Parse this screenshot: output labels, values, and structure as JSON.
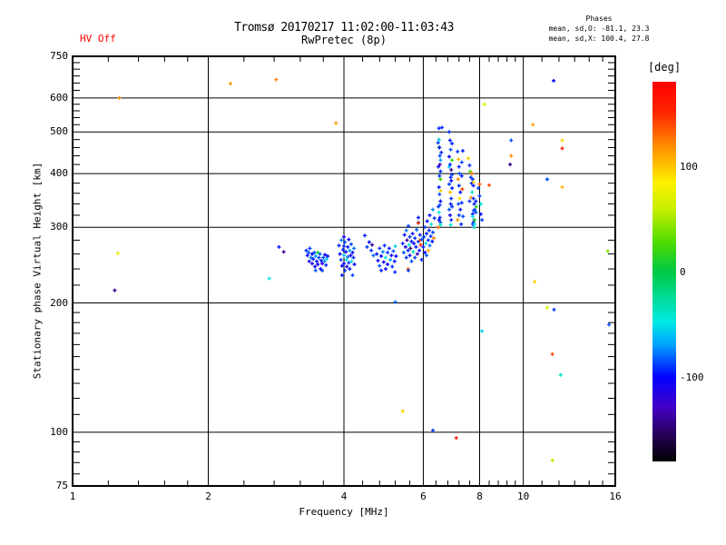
{
  "header": {
    "hv_status": "HV Off",
    "title_line1": "Tromsø 20170217 11:02:00-11:03:43",
    "title_line2": "RwPretec (8p)",
    "stats_title": "Phases",
    "stats_line1": "mean, sd,O: -81.1, 23.3",
    "stats_line2": "mean, sd,X: 100.4, 27.8"
  },
  "axes": {
    "x_label": "Frequency [MHz]",
    "y_label": "Stationary phase Virtual Height [km]"
  },
  "colorbar": {
    "label": "[deg]",
    "range": [
      -180,
      180
    ],
    "tick_values": [
      100,
      0,
      -100
    ],
    "tick_labels": [
      "100",
      "0",
      "-100"
    ],
    "stops": [
      [
        180,
        "#ff0000"
      ],
      [
        150,
        "#ff2600"
      ],
      [
        122,
        "#ff8400"
      ],
      [
        100,
        "#ffc300"
      ],
      [
        84,
        "#fdf200"
      ],
      [
        58,
        "#c2ee00"
      ],
      [
        28,
        "#4fdc00"
      ],
      [
        0,
        "#00c845"
      ],
      [
        -26,
        "#00dc9b"
      ],
      [
        -48,
        "#00e9e4"
      ],
      [
        -70,
        "#009fff"
      ],
      [
        -100,
        "#0202ff"
      ],
      [
        -128,
        "#4300c8"
      ],
      [
        -156,
        "#250054"
      ],
      [
        -180,
        "#000000"
      ]
    ]
  },
  "chart_data": {
    "type": "scatter",
    "title": "Tromsø 20170217 11:02:00-11:03:43",
    "subtitle": "RwPretec (8p)",
    "xlabel": "Frequency [MHz]",
    "ylabel": "Stationary phase Virtual Height [km]",
    "x_scale": "log",
    "y_scale": "log",
    "xlim": [
      1,
      16
    ],
    "ylim": [
      75,
      750
    ],
    "x_major_ticks": [
      1,
      2,
      4,
      6,
      8,
      10,
      16
    ],
    "y_major_ticks": [
      75,
      100,
      200,
      300,
      400,
      500,
      600,
      750
    ],
    "x_gridlines": [
      2,
      4,
      6,
      8,
      10
    ],
    "y_gridlines": [
      100,
      200,
      300,
      400,
      500,
      600
    ],
    "x_minor_ticks": [
      1.2,
      1.4,
      1.6,
      1.8,
      2.4,
      2.8,
      3.2,
      3.6,
      4.4,
      4.8,
      5.2,
      5.6,
      6.4,
      6.8,
      7.2,
      7.6,
      8.4,
      8.8,
      9.2,
      9.6,
      11,
      12,
      13,
      14,
      15
    ],
    "y_minor_ticks": [
      80,
      85,
      90,
      95,
      110,
      120,
      130,
      140,
      150,
      160,
      170,
      180,
      190,
      220,
      240,
      260,
      280,
      320,
      340,
      360,
      380,
      420,
      440,
      460,
      480,
      520,
      540,
      560,
      580,
      625,
      650,
      675,
      700,
      725
    ],
    "grid": true,
    "legend_position": "right-colorbar",
    "point_marker": "plus",
    "color_value": "phase [deg]",
    "points": [
      [
        1.24,
        214,
        -140
      ],
      [
        1.26,
        261,
        75
      ],
      [
        1.27,
        600,
        120
      ],
      [
        2.24,
        648,
        118
      ],
      [
        2.73,
        228,
        -48
      ],
      [
        2.83,
        662,
        125
      ],
      [
        2.87,
        270,
        -95
      ],
      [
        2.94,
        263,
        -140
      ],
      [
        3.84,
        524,
        115
      ],
      [
        3.3,
        265,
        -95
      ],
      [
        3.32,
        258,
        -102
      ],
      [
        3.34,
        262,
        -85
      ],
      [
        3.35,
        250,
        -106
      ],
      [
        3.36,
        268,
        -92
      ],
      [
        3.38,
        255,
        -78
      ],
      [
        3.4,
        260,
        -100
      ],
      [
        3.4,
        247,
        -112
      ],
      [
        3.42,
        253,
        -96
      ],
      [
        3.44,
        262,
        -88
      ],
      [
        3.45,
        243,
        -104
      ],
      [
        3.46,
        257,
        -72
      ],
      [
        3.46,
        238,
        -84
      ],
      [
        3.48,
        250,
        -98
      ],
      [
        3.5,
        262,
        10
      ],
      [
        3.5,
        246,
        -108
      ],
      [
        3.52,
        255,
        -90
      ],
      [
        3.54,
        260,
        -82
      ],
      [
        3.55,
        240,
        -100
      ],
      [
        3.56,
        251,
        -95
      ],
      [
        3.58,
        247,
        -118
      ],
      [
        3.58,
        238,
        -90
      ],
      [
        3.6,
        255,
        -86
      ],
      [
        3.62,
        250,
        -75
      ],
      [
        3.63,
        259,
        -102
      ],
      [
        3.65,
        245,
        -94
      ],
      [
        3.66,
        253,
        -60
      ],
      [
        3.68,
        257,
        -98
      ],
      [
        3.9,
        272,
        -96
      ],
      [
        3.92,
        260,
        -104
      ],
      [
        3.94,
        252,
        -88
      ],
      [
        3.95,
        280,
        -76
      ],
      [
        3.96,
        244,
        -100
      ],
      [
        3.96,
        232,
        -95
      ],
      [
        3.98,
        266,
        -92
      ],
      [
        4.0,
        285,
        -108
      ],
      [
        4.0,
        271,
        -95
      ],
      [
        4.0,
        258,
        -60
      ],
      [
        4.0,
        247,
        -102
      ],
      [
        4.02,
        277,
        -84
      ],
      [
        4.02,
        238,
        -90
      ],
      [
        4.04,
        263,
        -98
      ],
      [
        4.05,
        252,
        -45
      ],
      [
        4.06,
        243,
        -110
      ],
      [
        4.08,
        270,
        -94
      ],
      [
        4.08,
        256,
        -80
      ],
      [
        4.1,
        281,
        -100
      ],
      [
        4.1,
        248,
        -90
      ],
      [
        4.12,
        265,
        -70
      ],
      [
        4.12,
        240,
        -96
      ],
      [
        4.14,
        258,
        -105
      ],
      [
        4.15,
        274,
        -88
      ],
      [
        4.16,
        250,
        -52
      ],
      [
        4.18,
        262,
        -98
      ],
      [
        4.18,
        232,
        -86
      ],
      [
        4.2,
        255,
        -92
      ],
      [
        4.21,
        268,
        -78
      ],
      [
        4.22,
        246,
        -100
      ],
      [
        4.45,
        287,
        -95
      ],
      [
        4.5,
        270,
        -88
      ],
      [
        4.55,
        277,
        -100
      ],
      [
        4.6,
        265,
        -92
      ],
      [
        4.62,
        273,
        -140
      ],
      [
        4.65,
        258,
        -80
      ],
      [
        4.73,
        260,
        -96
      ],
      [
        4.76,
        251,
        -104
      ],
      [
        4.8,
        268,
        -90
      ],
      [
        4.8,
        244,
        -84
      ],
      [
        4.84,
        257,
        -100
      ],
      [
        4.84,
        238,
        -95
      ],
      [
        4.88,
        263,
        -75
      ],
      [
        4.9,
        249,
        -108
      ],
      [
        4.92,
        272,
        -92
      ],
      [
        4.95,
        255,
        -45
      ],
      [
        4.95,
        240,
        -98
      ],
      [
        5.0,
        262,
        -88
      ],
      [
        5.0,
        246,
        -100
      ],
      [
        5.04,
        268,
        -94
      ],
      [
        5.07,
        252,
        -70
      ],
      [
        5.1,
        258,
        -102
      ],
      [
        5.12,
        243,
        -90
      ],
      [
        5.15,
        264,
        -85
      ],
      [
        5.18,
        250,
        -96
      ],
      [
        5.2,
        271,
        -55
      ],
      [
        5.22,
        257,
        -100
      ],
      [
        5.19,
        236,
        -92
      ],
      [
        5.55,
        240,
        128
      ],
      [
        5.2,
        201,
        -80
      ],
      [
        5.4,
        275,
        -95
      ],
      [
        5.43,
        262,
        -85
      ],
      [
        5.45,
        288,
        -100
      ],
      [
        5.48,
        270,
        -110
      ],
      [
        5.5,
        255,
        -92
      ],
      [
        5.5,
        295,
        -78
      ],
      [
        5.52,
        280,
        -135
      ],
      [
        5.55,
        265,
        -96
      ],
      [
        5.56,
        302,
        -88
      ],
      [
        5.56,
        238,
        -90
      ],
      [
        5.58,
        273,
        -45
      ],
      [
        5.6,
        258,
        -100
      ],
      [
        5.6,
        285,
        -90
      ],
      [
        5.62,
        268,
        -150
      ],
      [
        5.65,
        278,
        -94
      ],
      [
        5.65,
        250,
        -85
      ],
      [
        5.68,
        290,
        -98
      ],
      [
        5.7,
        263,
        -30
      ],
      [
        5.72,
        275,
        -105
      ],
      [
        5.75,
        283,
        -92
      ],
      [
        5.75,
        255,
        -88
      ],
      [
        5.78,
        270,
        -96
      ],
      [
        5.8,
        296,
        -82
      ],
      [
        5.82,
        260,
        -135
      ],
      [
        5.85,
        278,
        -90
      ],
      [
        5.85,
        308,
        -70
      ],
      [
        5.85,
        316,
        -96
      ],
      [
        5.88,
        265,
        -100
      ],
      [
        5.9,
        288,
        -94
      ],
      [
        5.9,
        280,
        140
      ],
      [
        5.85,
        307,
        150
      ],
      [
        5.92,
        273,
        155
      ],
      [
        5.95,
        281,
        -86
      ],
      [
        5.95,
        252,
        -92
      ],
      [
        6.0,
        270,
        -95
      ],
      [
        6.02,
        285,
        -88
      ],
      [
        6.05,
        262,
        -100
      ],
      [
        6.05,
        300,
        -92
      ],
      [
        6.08,
        275,
        -55
      ],
      [
        6.1,
        290,
        -96
      ],
      [
        6.1,
        258,
        -85
      ],
      [
        6.12,
        310,
        -100
      ],
      [
        6.15,
        280,
        -90
      ],
      [
        6.15,
        265,
        110
      ],
      [
        6.18,
        295,
        -94
      ],
      [
        6.2,
        272,
        -80
      ],
      [
        6.2,
        320,
        -98
      ],
      [
        6.23,
        286,
        -92
      ],
      [
        6.25,
        305,
        -45
      ],
      [
        6.28,
        278,
        -96
      ],
      [
        6.3,
        292,
        -88
      ],
      [
        6.3,
        330,
        -75
      ],
      [
        6.33,
        283,
        125
      ],
      [
        6.35,
        315,
        -90
      ],
      [
        6.47,
        472,
        -88
      ],
      [
        6.48,
        335,
        -90
      ],
      [
        6.48,
        415,
        -98
      ],
      [
        6.48,
        300,
        130
      ],
      [
        6.5,
        510,
        -95
      ],
      [
        6.5,
        480,
        -60
      ],
      [
        6.5,
        460,
        15
      ],
      [
        6.5,
        372,
        -96
      ],
      [
        6.5,
        325,
        -45
      ],
      [
        6.5,
        312,
        -96
      ],
      [
        6.52,
        460,
        -100
      ],
      [
        6.52,
        358,
        -85
      ],
      [
        6.52,
        395,
        -90
      ],
      [
        6.53,
        440,
        -88
      ],
      [
        6.53,
        420,
        -135
      ],
      [
        6.53,
        316,
        -94
      ],
      [
        6.53,
        338,
        -86
      ],
      [
        6.55,
        405,
        -92
      ],
      [
        6.55,
        388,
        25
      ],
      [
        6.55,
        345,
        -100
      ],
      [
        6.55,
        308,
        -88
      ],
      [
        6.55,
        430,
        -70
      ],
      [
        6.55,
        365,
        95
      ],
      [
        6.55,
        304,
        -40
      ],
      [
        6.58,
        448,
        -94
      ],
      [
        6.6,
        512,
        -92
      ],
      [
        6.85,
        500,
        -92
      ],
      [
        6.85,
        438,
        -100
      ],
      [
        6.85,
        378,
        -88
      ],
      [
        6.85,
        330,
        -85
      ],
      [
        6.85,
        415,
        -60
      ],
      [
        6.88,
        478,
        -96
      ],
      [
        6.88,
        420,
        -90
      ],
      [
        6.88,
        362,
        100
      ],
      [
        6.88,
        320,
        -100
      ],
      [
        6.9,
        455,
        -85
      ],
      [
        6.9,
        392,
        -94
      ],
      [
        6.9,
        340,
        -96
      ],
      [
        6.9,
        304,
        -45
      ],
      [
        6.92,
        408,
        -140
      ],
      [
        6.92,
        350,
        -92
      ],
      [
        6.92,
        312,
        -90
      ],
      [
        6.92,
        385,
        -100
      ],
      [
        6.95,
        470,
        -94
      ],
      [
        6.95,
        430,
        20
      ],
      [
        6.95,
        398,
        -88
      ],
      [
        6.95,
        370,
        -96
      ],
      [
        6.95,
        335,
        -92
      ],
      [
        7.15,
        450,
        -90
      ],
      [
        7.15,
        312,
        115
      ],
      [
        7.17,
        388,
        120
      ],
      [
        7.18,
        432,
        105
      ],
      [
        7.18,
        340,
        -88
      ],
      [
        7.2,
        415,
        -94
      ],
      [
        7.2,
        375,
        -92
      ],
      [
        7.2,
        320,
        -90
      ],
      [
        7.22,
        400,
        -85
      ],
      [
        7.22,
        350,
        90
      ],
      [
        7.25,
        362,
        -96
      ],
      [
        7.25,
        330,
        -100
      ],
      [
        7.28,
        305,
        -94
      ],
      [
        7.3,
        425,
        -88
      ],
      [
        7.3,
        395,
        -96
      ],
      [
        7.3,
        342,
        -92
      ],
      [
        7.32,
        368,
        140
      ],
      [
        7.34,
        452,
        -95
      ],
      [
        7.35,
        318,
        -86
      ],
      [
        7.55,
        434,
        95
      ],
      [
        7.6,
        418,
        -92
      ],
      [
        7.6,
        345,
        -92
      ],
      [
        7.62,
        405,
        30
      ],
      [
        7.65,
        392,
        -88
      ],
      [
        7.65,
        352,
        110
      ],
      [
        7.68,
        380,
        -96
      ],
      [
        7.69,
        400,
        128
      ],
      [
        7.7,
        362,
        -45
      ],
      [
        7.72,
        388,
        -90
      ],
      [
        7.72,
        322,
        -100
      ],
      [
        7.72,
        318,
        -50
      ],
      [
        7.73,
        305,
        -95
      ],
      [
        7.75,
        375,
        -94
      ],
      [
        7.75,
        350,
        -92
      ],
      [
        7.75,
        308,
        -90
      ],
      [
        7.75,
        382,
        95
      ],
      [
        7.76,
        328,
        -85
      ],
      [
        7.78,
        340,
        -96
      ],
      [
        7.78,
        312,
        -90
      ],
      [
        7.78,
        300,
        -40
      ],
      [
        7.8,
        330,
        -88
      ],
      [
        7.8,
        305,
        -50
      ],
      [
        7.8,
        312,
        20
      ],
      [
        7.85,
        345,
        -94
      ],
      [
        7.85,
        325,
        -88
      ],
      [
        7.87,
        335,
        15
      ],
      [
        7.95,
        370,
        -90
      ],
      [
        8.0,
        378,
        135
      ],
      [
        8.0,
        355,
        -92
      ],
      [
        8.05,
        340,
        -45
      ],
      [
        8.05,
        322,
        -96
      ],
      [
        8.1,
        312,
        -88
      ],
      [
        8.4,
        376,
        140
      ],
      [
        8.2,
        580,
        70
      ],
      [
        9.4,
        478,
        -85
      ],
      [
        9.4,
        440,
        120
      ],
      [
        9.35,
        420,
        -145
      ],
      [
        10.5,
        520,
        110
      ],
      [
        11.68,
        658,
        -105
      ],
      [
        12.2,
        478,
        95
      ],
      [
        12.2,
        458,
        160
      ],
      [
        11.3,
        388,
        -88
      ],
      [
        12.2,
        372,
        105
      ],
      [
        15.4,
        264,
        40
      ],
      [
        10.6,
        224,
        95
      ],
      [
        11.3,
        195,
        65
      ],
      [
        11.7,
        193,
        -90
      ],
      [
        15.5,
        178,
        -85
      ],
      [
        8.1,
        172,
        -55
      ],
      [
        11.6,
        152,
        140
      ],
      [
        12.1,
        136,
        -40
      ],
      [
        5.4,
        112,
        95
      ],
      [
        6.3,
        101,
        -90
      ],
      [
        7.1,
        97,
        160
      ],
      [
        11.6,
        86,
        55
      ]
    ]
  }
}
